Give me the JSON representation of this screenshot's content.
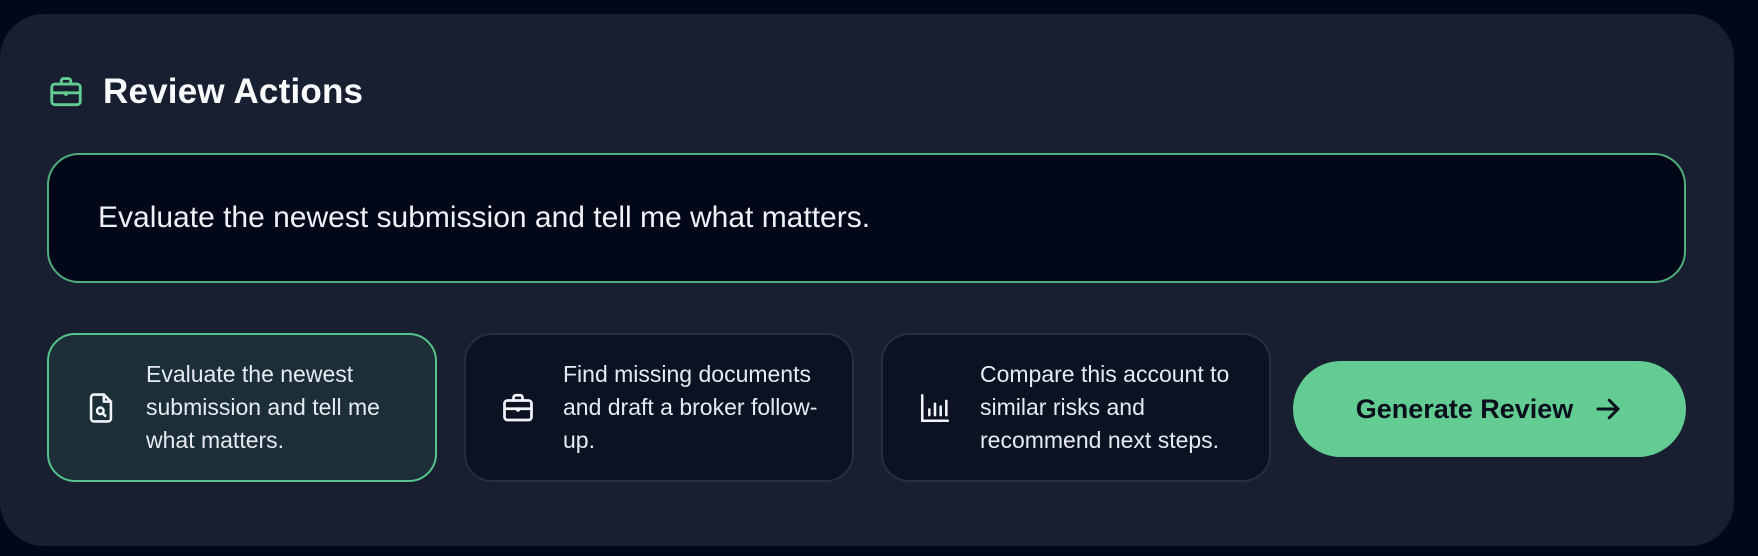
{
  "header": {
    "title": "Review Actions",
    "icon": "briefcase-icon"
  },
  "prompt": {
    "value": "Evaluate the newest submission and tell me what matters."
  },
  "suggestions": [
    {
      "label": "Evaluate the newest submission and tell me what matters.",
      "icon": "document-search-icon",
      "active": true
    },
    {
      "label": "Find missing documents and draft a broker follow-up.",
      "icon": "briefcase-icon",
      "active": false
    },
    {
      "label": "Compare this account to similar risks and recommend next steps.",
      "icon": "bar-chart-icon",
      "active": false
    }
  ],
  "generate": {
    "label": "Generate Review",
    "icon": "arrow-right-icon"
  },
  "colors": {
    "accent": "#63cc92",
    "panel": "#181f31",
    "background": "#020817"
  }
}
